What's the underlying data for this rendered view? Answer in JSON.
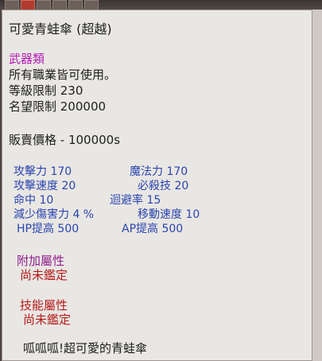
{
  "item": {
    "title": "可愛青蛙傘 (超越)",
    "category": "武器類",
    "job_requirement": "所有職業皆可使用。",
    "level_limit": "等級限制 230",
    "fame_limit": "名望限制 200000",
    "sell_price": "販賣價格 - 100000s"
  },
  "stats": {
    "attack": "攻擊力 170",
    "magic": "魔法力 170",
    "attack_speed": "攻擊速度 20",
    "crit": "必殺技 20",
    "accuracy": "命中 10",
    "evasion": "迴避率 15",
    "damage_reduction": "減少傷害力 4 %",
    "move_speed": "移動速度 10",
    "hp_up": "HP提高 500",
    "ap_up": "AP提高 500"
  },
  "extra": {
    "attr_heading": "附加屬性",
    "attr_value": "尚未鑑定",
    "skill_heading": "技能屬性",
    "skill_value": "尚未鑑定",
    "description": "呱呱呱!超可愛的青蛙傘"
  },
  "colors": {
    "panel_bg": "#e9e7e3",
    "stat_blue": "#2a44b0",
    "category_magenta": "#b21fb5",
    "unidentified_red": "#b31a1a"
  }
}
